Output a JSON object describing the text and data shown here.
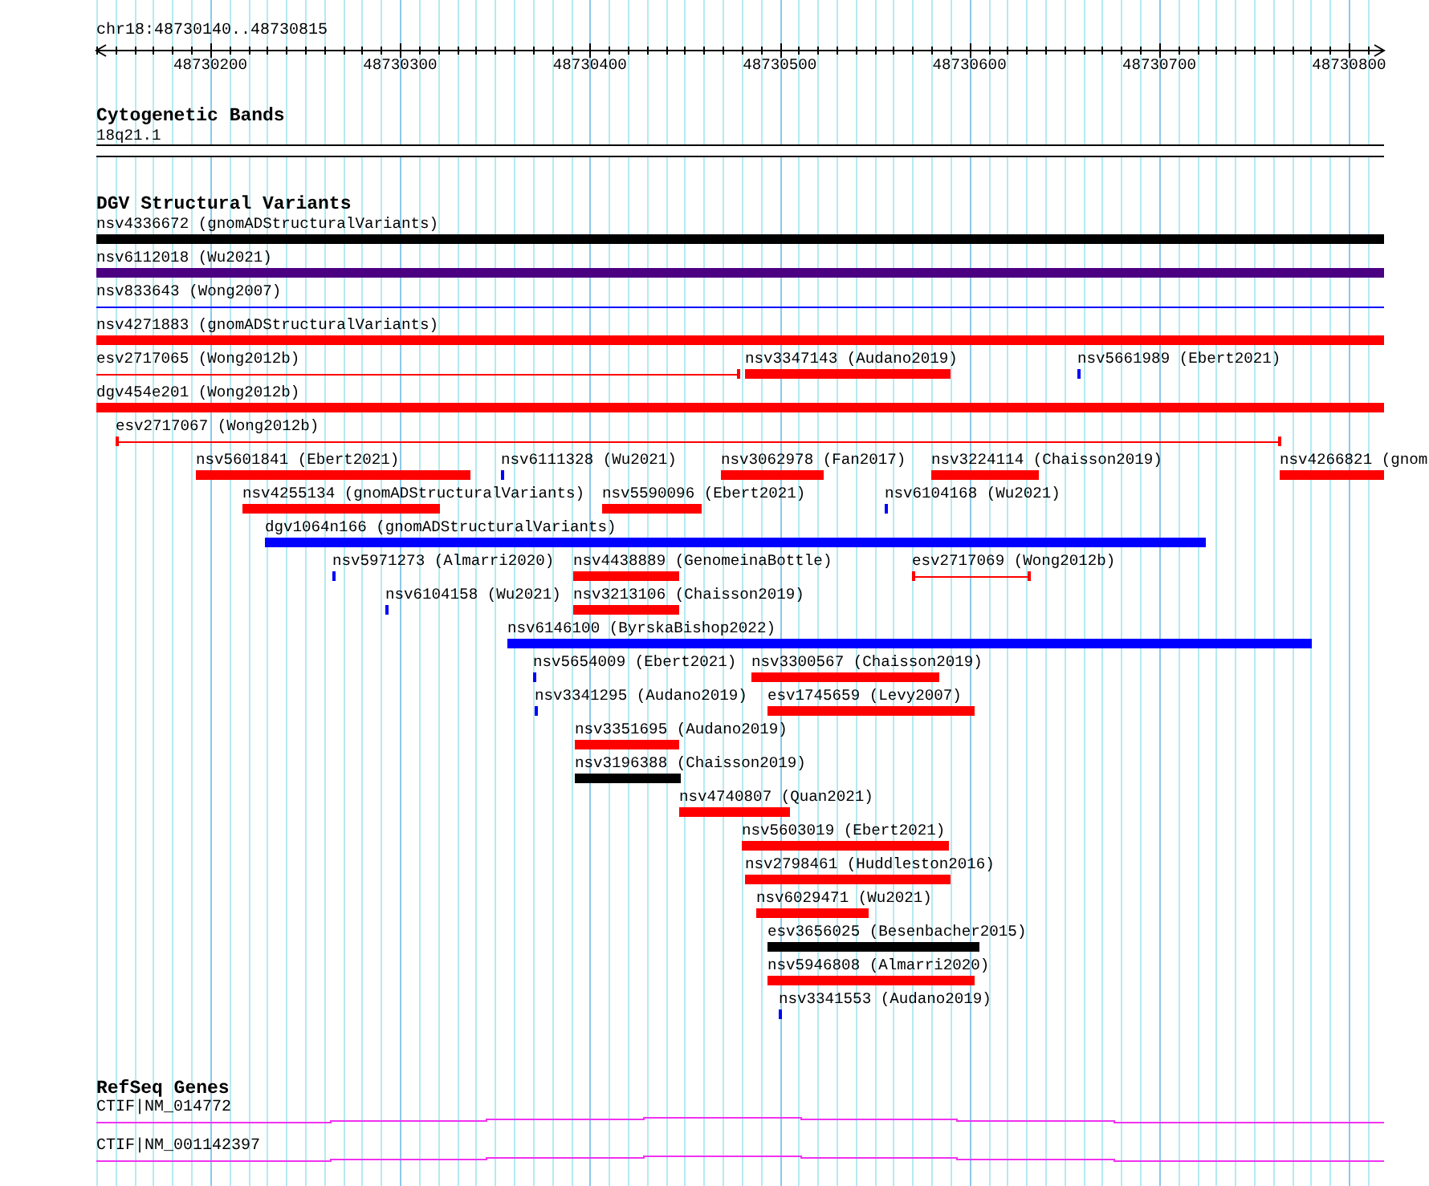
{
  "ruler": {
    "location": "chr18:48730140..48730815",
    "tick_labels": [
      "48730200",
      "48730300",
      "48730400",
      "48730500",
      "48730600",
      "48730700",
      "48730800"
    ]
  },
  "tracks": [
    {
      "kind": "cytoband",
      "title": "Cytogenetic Bands",
      "rows": [
        {
          "features": [
            {
              "label": "18q21.1"
            }
          ]
        }
      ]
    },
    {
      "kind": "variants",
      "title": "DGV Structural Variants",
      "rows": [
        {
          "features": [
            {
              "label": "nsv4336672 (gnomADStructuralVariants)",
              "kind": "bar",
              "color": "#000000"
            }
          ]
        },
        {
          "features": [
            {
              "label": "nsv6112018 (Wu2021)",
              "kind": "bar",
              "color": "#4b0082"
            }
          ]
        },
        {
          "features": [
            {
              "label": "nsv833643 (Wong2007)",
              "kind": "line",
              "color": "#0000ff"
            }
          ]
        },
        {
          "features": [
            {
              "label": "nsv4271883 (gnomADStructuralVariants)",
              "kind": "bar",
              "color": "#ff0000"
            }
          ]
        },
        {
          "features": [
            {
              "label": "esv2717065 (Wong2012b)",
              "kind": "line",
              "color": "#ff0000"
            },
            {
              "label": "nsv3347143 (Audano2019)",
              "kind": "bar",
              "color": "#ff0000"
            },
            {
              "label": "nsv5661989 (Ebert2021)",
              "kind": "bar",
              "color": "#0000ff"
            }
          ]
        },
        {
          "features": [
            {
              "label": "dgv454e201 (Wong2012b)",
              "kind": "bar",
              "color": "#ff0000"
            }
          ]
        },
        {
          "features": [
            {
              "label": "esv2717067 (Wong2012b)",
              "kind": "line",
              "color": "#ff0000"
            }
          ]
        },
        {
          "features": [
            {
              "label": "nsv5601841 (Ebert2021)",
              "kind": "bar",
              "color": "#ff0000"
            },
            {
              "label": "nsv6111328 (Wu2021)",
              "kind": "bar",
              "color": "#0000ff"
            },
            {
              "label": "nsv3062978 (Fan2017)",
              "kind": "bar",
              "color": "#ff0000"
            },
            {
              "label": "nsv3224114 (Chaisson2019)",
              "kind": "bar",
              "color": "#ff0000"
            },
            {
              "label": "nsv4266821 (gnom",
              "kind": "bar",
              "color": "#ff0000"
            }
          ]
        },
        {
          "features": [
            {
              "label": "nsv4255134 (gnomADStructuralVariants)",
              "kind": "bar",
              "color": "#ff0000"
            },
            {
              "label": "nsv5590096 (Ebert2021)",
              "kind": "bar",
              "color": "#ff0000"
            },
            {
              "label": "nsv6104168 (Wu2021)",
              "kind": "bar",
              "color": "#0000ff"
            }
          ]
        },
        {
          "features": [
            {
              "label": "dgv1064n166 (gnomADStructuralVariants)",
              "kind": "bar",
              "color": "#0000ff"
            }
          ]
        },
        {
          "features": [
            {
              "label": "nsv5971273 (Almarri2020)",
              "kind": "bar",
              "color": "#0000ff"
            },
            {
              "label": "nsv4438889 (GenomeinaBottle)",
              "kind": "bar",
              "color": "#ff0000"
            },
            {
              "label": "esv2717069 (Wong2012b)",
              "kind": "line",
              "color": "#ff0000"
            }
          ]
        },
        {
          "features": [
            {
              "label": "nsv6104158 (Wu2021)",
              "kind": "bar",
              "color": "#0000ff"
            },
            {
              "label": "nsv3213106 (Chaisson2019)",
              "kind": "bar",
              "color": "#ff0000"
            }
          ]
        },
        {
          "features": [
            {
              "label": "nsv6146100 (ByrskaBishop2022)",
              "kind": "bar",
              "color": "#0000ff"
            }
          ]
        },
        {
          "features": [
            {
              "label": "nsv5654009 (Ebert2021)",
              "kind": "bar",
              "color": "#0000ff"
            },
            {
              "label": "nsv3300567 (Chaisson2019)",
              "kind": "bar",
              "color": "#ff0000"
            }
          ]
        },
        {
          "features": [
            {
              "label": "nsv3341295 (Audano2019)",
              "kind": "bar",
              "color": "#0000ff"
            },
            {
              "label": "esv1745659 (Levy2007)",
              "kind": "bar",
              "color": "#ff0000"
            }
          ]
        },
        {
          "features": [
            {
              "label": "nsv3351695 (Audano2019)",
              "kind": "bar",
              "color": "#ff0000"
            }
          ]
        },
        {
          "features": [
            {
              "label": "nsv3196388 (Chaisson2019)",
              "kind": "bar",
              "color": "#000000"
            }
          ]
        },
        {
          "features": [
            {
              "label": "nsv4740807 (Quan2021)",
              "kind": "bar",
              "color": "#ff0000"
            }
          ]
        },
        {
          "features": [
            {
              "label": "nsv5603019 (Ebert2021)",
              "kind": "bar",
              "color": "#ff0000"
            }
          ]
        },
        {
          "features": [
            {
              "label": "nsv2798461 (Huddleston2016)",
              "kind": "bar",
              "color": "#ff0000"
            }
          ]
        },
        {
          "features": [
            {
              "label": "nsv6029471 (Wu2021)",
              "kind": "bar",
              "color": "#ff0000"
            }
          ]
        },
        {
          "features": [
            {
              "label": "esv3656025 (Besenbacher2015)",
              "kind": "bar",
              "color": "#000000"
            }
          ]
        },
        {
          "features": [
            {
              "label": "nsv5946808 (Almarri2020)",
              "kind": "bar",
              "color": "#ff0000"
            }
          ]
        },
        {
          "features": [
            {
              "label": "nsv3341553 (Audano2019)",
              "kind": "bar",
              "color": "#0000ff"
            }
          ]
        }
      ]
    },
    {
      "kind": "genes",
      "title": "RefSeq Genes",
      "rows": [
        {
          "features": [
            {
              "label": "CTIF|NM_014772"
            }
          ]
        },
        {
          "features": [
            {
              "label": "CTIF|NM_001142397"
            }
          ]
        }
      ]
    }
  ]
}
